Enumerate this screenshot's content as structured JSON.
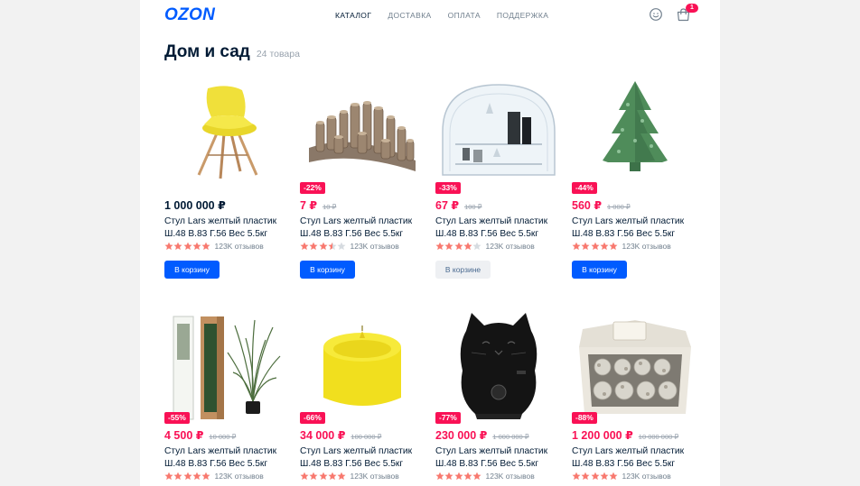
{
  "header": {
    "logo": "OZON",
    "nav": [
      {
        "label": "Каталог",
        "active": true
      },
      {
        "label": "Доставка",
        "active": false
      },
      {
        "label": "Оплата",
        "active": false
      },
      {
        "label": "Поддержка",
        "active": false
      }
    ],
    "user_icon": "smiley-user-icon",
    "cart_icon": "shopping-bag-icon",
    "cart_badge": "1"
  },
  "page": {
    "title": "Дом и сад",
    "count": "24 товара"
  },
  "colors": {
    "brand": "#005bff",
    "sale": "#f91155",
    "star_filled": "#f8796f",
    "star_empty": "#d6dbe0"
  },
  "products": [
    {
      "image": "yellow-chair",
      "discount": "",
      "price": "1 000 000 ₽",
      "old_price": "",
      "name": "Стул Lars желтый пластик Ш.48 В.83 Г.56 Вес 5.5кг",
      "rating": 5,
      "reviews": "123K отзывов",
      "button": "В корзину",
      "in_cart": false
    },
    {
      "image": "wooden-log-stand",
      "discount": "-22%",
      "price": "7 ₽",
      "old_price": "10 ₽",
      "name": "Стул Lars желтый пластик Ш.48 В.83 Г.56 Вес 5.5кг",
      "rating": 3.5,
      "reviews": "123K отзывов",
      "button": "В корзину",
      "in_cart": false
    },
    {
      "image": "glass-shelf",
      "discount": "-33%",
      "price": "67 ₽",
      "old_price": "100 ₽",
      "name": "Стул Lars желтый пластик Ш.48 В.83 Г.56 Вес 5.5кг",
      "rating": 4,
      "reviews": "123K отзывов",
      "button": "В корзине",
      "in_cart": true
    },
    {
      "image": "tree-candle",
      "discount": "-44%",
      "price": "560 ₽",
      "old_price": "1 000 ₽",
      "name": "Стул Lars желтый пластик Ш.48 В.83 Г.56 Вес 5.5кг",
      "rating": 5,
      "reviews": "123K отзывов",
      "button": "В корзину",
      "in_cart": false
    },
    {
      "image": "artificial-plant",
      "discount": "-55%",
      "price": "4 500 ₽",
      "old_price": "10 000 ₽",
      "name": "Стул Lars желтый пластик Ш.48 В.83 Г.56 Вес 5.5кг",
      "rating": 5,
      "reviews": "123K отзывов",
      "button": "",
      "in_cart": false
    },
    {
      "image": "yellow-candle",
      "discount": "-66%",
      "price": "34 000 ₽",
      "old_price": "100 000 ₽",
      "name": "Стул Lars желтый пластик Ш.48 В.83 Г.56 Вес 5.5кг",
      "rating": 5,
      "reviews": "123K отзывов",
      "button": "",
      "in_cart": false
    },
    {
      "image": "cat-humidifier",
      "discount": "-77%",
      "price": "230 000 ₽",
      "old_price": "1 000 000 ₽",
      "name": "Стул Lars желтый пластик Ш.48 В.83 Г.56 Вес 5.5кг",
      "rating": 5,
      "reviews": "123K отзывов",
      "button": "",
      "in_cart": false
    },
    {
      "image": "ornament-box",
      "discount": "-88%",
      "price": "1 200 000 ₽",
      "old_price": "10 000 000 ₽",
      "name": "Стул Lars желтый пластик Ш.48 В.83 Г.56 Вес 5.5кг",
      "rating": 5,
      "reviews": "123K отзывов",
      "button": "",
      "in_cart": false
    }
  ]
}
